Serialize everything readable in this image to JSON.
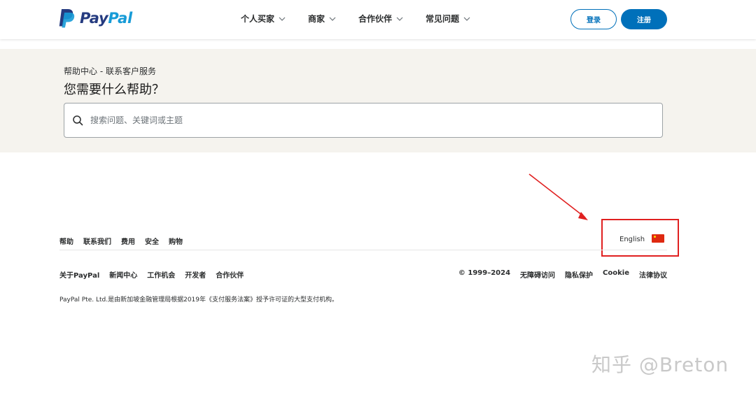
{
  "header": {
    "logo": {
      "part1": "Pay",
      "part2": "Pal"
    },
    "nav": [
      {
        "label": "个人买家"
      },
      {
        "label": "商家"
      },
      {
        "label": "合作伙伴"
      },
      {
        "label": "常见问题"
      }
    ],
    "login_label": "登录",
    "signup_label": "注册"
  },
  "hero": {
    "breadcrumb": "帮助中心 - 联系客户服务",
    "title": "您需要什么帮助？",
    "search_placeholder": "搜索问题、关键词或主题"
  },
  "footer": {
    "links": [
      "帮助",
      "联系我们",
      "费用",
      "安全",
      "购物"
    ],
    "language": "English",
    "row2_left": [
      "关于PayPal",
      "新闻中心",
      "工作机会",
      "开发者",
      "合作伙伴"
    ],
    "row2_right": [
      "© 1999–2024",
      "无障碍访问",
      "隐私保护",
      "Cookie",
      "法律协议"
    ],
    "legal": "PayPal Pte. Ltd.是由新加坡金融管理局根据2019年《支付服务法案》授予许可证的大型支付机构。"
  },
  "watermark": "知乎 @Breton",
  "colors": {
    "brand_blue": "#0070ba",
    "hero_bg": "#f5f3ee",
    "annotation_red": "#e02020"
  }
}
